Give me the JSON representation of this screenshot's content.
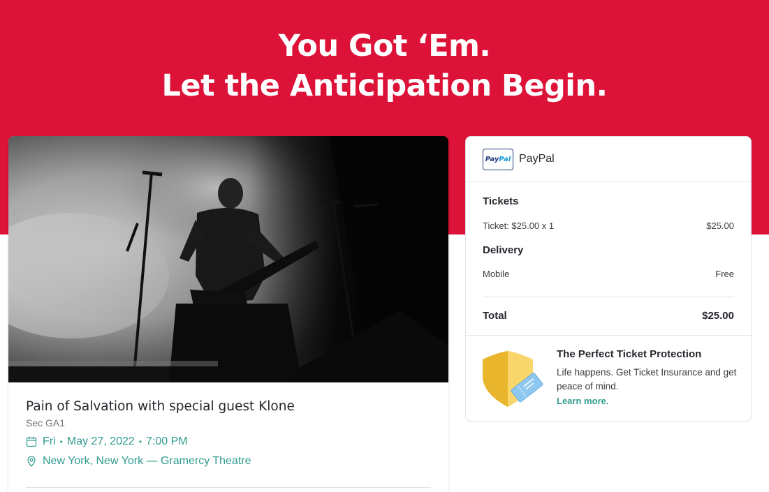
{
  "hero": {
    "line1": "You Got ‘Em.",
    "line2": "Let the Anticipation Begin.",
    "background_color": "#dc1238"
  },
  "event": {
    "title": "Pain of Salvation with special guest Klone",
    "section": "Sec GA1",
    "day": "Fri",
    "date": "May 27, 2022",
    "time": "7:00 PM",
    "separator": "•",
    "location": "New York, New York — Gramercy Theatre",
    "icons": {
      "date": "calendar-icon",
      "location": "map-pin-icon"
    },
    "link_color": "#2f9c8e"
  },
  "payment": {
    "method": "PayPal",
    "logo_text_1": "Pay",
    "logo_text_2": "Pal"
  },
  "summary": {
    "tickets_heading": "Tickets",
    "ticket_line_label": "Ticket: $25.00 x 1",
    "ticket_line_value": "$25.00",
    "delivery_heading": "Delivery",
    "delivery_method": "Mobile",
    "delivery_cost": "Free",
    "total_label": "Total",
    "total_value": "$25.00"
  },
  "protection": {
    "title": "The Perfect Ticket Protection",
    "description": "Life happens. Get Ticket Insurance and get peace of mind.",
    "link": "Learn more.",
    "icon": "shield-ticket-icon"
  }
}
